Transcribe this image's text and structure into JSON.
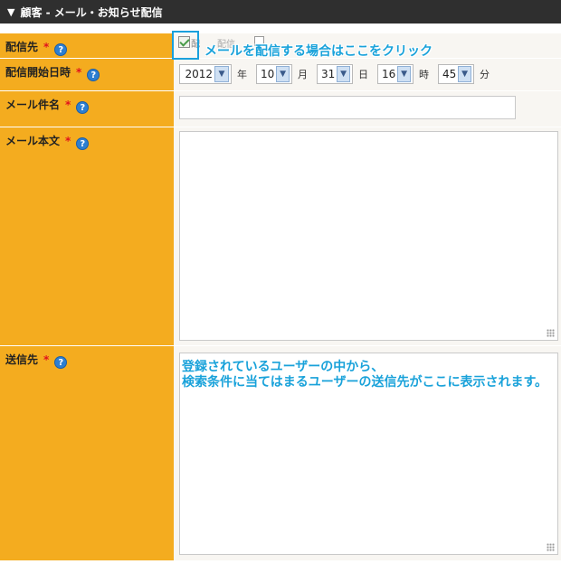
{
  "header": {
    "title": "顧客 - メール・お知らせ配信"
  },
  "form": {
    "required_mark": "*",
    "help_glyph": "?",
    "fields": {
      "destination": {
        "label": "配信先",
        "checkbox_checked": true,
        "option_fragment_1": "配",
        "option_fragment_2": "配信"
      },
      "start_datetime": {
        "label": "配信開始日時",
        "year": "2012",
        "year_unit": "年",
        "month": "10",
        "month_unit": "月",
        "day": "31",
        "day_unit": "日",
        "hour": "16",
        "hour_unit": "時",
        "minute": "45",
        "minute_unit": "分"
      },
      "subject": {
        "label": "メール件名",
        "value": ""
      },
      "body": {
        "label": "メール本文",
        "value": ""
      },
      "recipients": {
        "label": "送信先"
      }
    }
  },
  "annotations": {
    "checkbox_hint": "メールを配信する場合はここをクリック",
    "recipients_hint_line1": "登録されているユーザーの中から、",
    "recipients_hint_line2": "検索条件に当てはまるユーザーの送信先がここに表示されます。"
  },
  "colors": {
    "label_bg": "#f4ac1f",
    "header_bg": "#2f2f2f",
    "callout": "#19a2da",
    "required": "#e0131d"
  },
  "icons": {
    "header_toggle": "triangle-down-icon",
    "help": "help-icon",
    "select_arrow": "chevron-down-icon"
  }
}
